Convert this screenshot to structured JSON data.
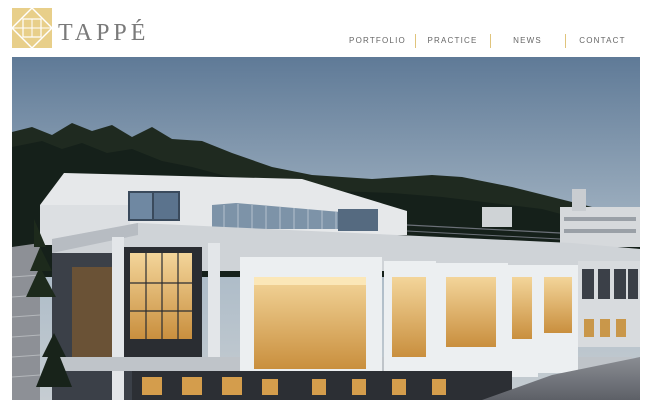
{
  "brand": {
    "name": "TAPPÉ",
    "logo_color": "#e8cf8a"
  },
  "nav": {
    "items": [
      {
        "label": "PORTFOLIO"
      },
      {
        "label": "PRACTICE"
      },
      {
        "label": "NEWS"
      },
      {
        "label": "CONTACT"
      }
    ]
  },
  "colors": {
    "nav_divider": "#e0c47c",
    "nav_text": "#666666",
    "brand_text": "#7a7a7a"
  },
  "hero": {
    "subject": "photo-building-at-dusk"
  }
}
